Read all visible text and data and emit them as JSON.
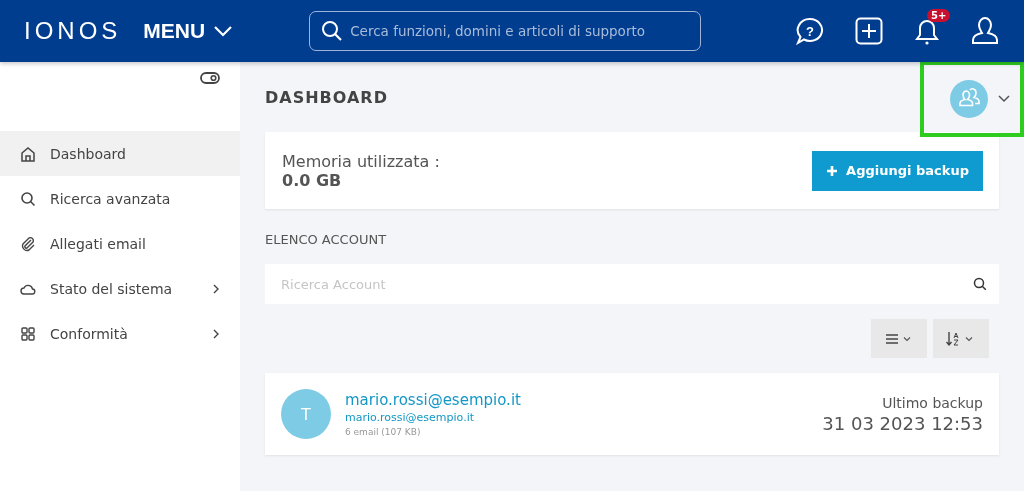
{
  "header": {
    "logo": "IONOS",
    "menu": "MENU",
    "search": {
      "placeholder": "Cerca funzioni, domini e articoli di supporto"
    },
    "help": "?",
    "notifications": "5+"
  },
  "sidebar": {
    "items": [
      {
        "label": "Dashboard",
        "kind": "home",
        "selected": true,
        "has_children": false
      },
      {
        "label": "Ricerca avanzata",
        "kind": "search",
        "selected": false,
        "has_children": false
      },
      {
        "label": "Allegati email",
        "kind": "attachments",
        "selected": false,
        "has_children": false
      },
      {
        "label": "Stato del sistema",
        "kind": "status",
        "selected": false,
        "has_children": true
      },
      {
        "label": "Conformità",
        "kind": "compliance",
        "selected": false,
        "has_children": true
      }
    ]
  },
  "page": {
    "title": "DASHBOARD",
    "account_switcher": {
      "highlighted": true
    }
  },
  "storage": {
    "label": "Memoria utilizzata :",
    "value": "0.0 GB",
    "button": "Aggiungi backup"
  },
  "accounts": {
    "heading": "ELENCO ACCOUNT",
    "search": {
      "placeholder": "Ricerca Account"
    },
    "items": [
      {
        "initial": "T",
        "name": "mario.rossi@esempio.it",
        "email": "mario.rossi@esempio.it",
        "details": "6 email (107 KB)",
        "backup_label": "Ultimo backup",
        "backup_date": "31 03 2023 12:53"
      }
    ]
  }
}
